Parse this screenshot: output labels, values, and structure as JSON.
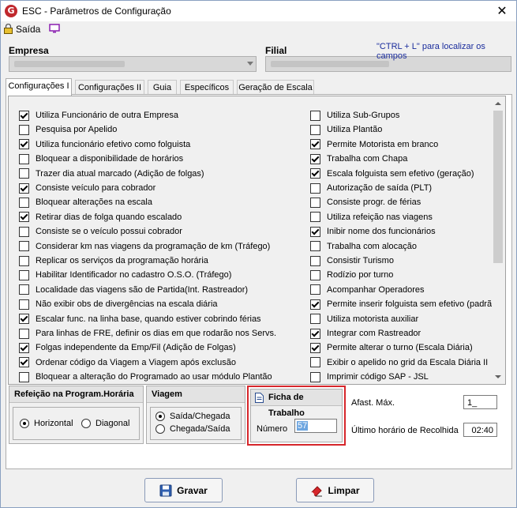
{
  "window": {
    "title": "ESC - Parâmetros de Configuração",
    "close_glyph": "✕",
    "app_glyph": "G"
  },
  "toolbar": {
    "exit_label": "Saída"
  },
  "hint": "\"CTRL + L\" para localizar os campos",
  "header": {
    "empresa_label": "Empresa",
    "filial_label": "Filial"
  },
  "tabs": [
    "Configurações I",
    "Configurações II",
    "Guia",
    "Específicos",
    "Geração de Escala"
  ],
  "left_options": [
    {
      "label": "Utiliza Funcionário de outra Empresa",
      "checked": true
    },
    {
      "label": "Pesquisa por Apelido",
      "checked": false
    },
    {
      "label": "Utiliza funcionário efetivo como folguista",
      "checked": true
    },
    {
      "label": "Bloquear a disponibilidade de horários",
      "checked": false
    },
    {
      "label": "Trazer dia atual marcado (Adição de folgas)",
      "checked": false
    },
    {
      "label": "Consiste veículo para cobrador",
      "checked": true
    },
    {
      "label": "Bloquear alterações na escala",
      "checked": false
    },
    {
      "label": "Retirar dias de folga quando escalado",
      "checked": true
    },
    {
      "label": "Consiste se o veículo possui cobrador",
      "checked": false
    },
    {
      "label": "Considerar km nas viagens da programação de km (Tráfego)",
      "checked": false
    },
    {
      "label": "Replicar os serviços da programação horária",
      "checked": false
    },
    {
      "label": "Habilitar Identificador no cadastro O.S.O. (Tráfego)",
      "checked": false
    },
    {
      "label": "Localidade das viagens são de Partida(Int. Rastreador)",
      "checked": false
    },
    {
      "label": "Não exibir obs de divergências na escala diária",
      "checked": false
    },
    {
      "label": "Escalar func. na linha base, quando estiver cobrindo férias",
      "checked": true
    },
    {
      "label": "Para linhas de FRE, definir os dias em que rodarão nos Servs.",
      "checked": false
    },
    {
      "label": "Folgas independente da Emp/Fil (Adição de Folgas)",
      "checked": true
    },
    {
      "label": "Ordenar código da Viagem a Viagem após exclusão",
      "checked": true
    },
    {
      "label": "Bloquear a alteração do Programado ao usar módulo Plantão",
      "checked": false
    }
  ],
  "right_options": [
    {
      "label": "Utiliza Sub-Grupos",
      "checked": false
    },
    {
      "label": "Utiliza Plantão",
      "checked": false
    },
    {
      "label": "Permite Motorista em branco",
      "checked": true
    },
    {
      "label": "Trabalha com Chapa",
      "checked": true
    },
    {
      "label": "Escala folguista sem efetivo (geração)",
      "checked": true
    },
    {
      "label": "Autorização de saída (PLT)",
      "checked": false
    },
    {
      "label": "Consiste progr. de férias",
      "checked": false
    },
    {
      "label": "Utiliza refeição nas viagens",
      "checked": false
    },
    {
      "label": "Inibir nome dos funcionários",
      "checked": true
    },
    {
      "label": "Trabalha com alocação",
      "checked": false
    },
    {
      "label": "Consistir Turismo",
      "checked": false
    },
    {
      "label": "Rodízio por turno",
      "checked": false
    },
    {
      "label": "Acompanhar Operadores",
      "checked": false
    },
    {
      "label": "Permite inserir folguista sem efetivo (padrão)",
      "checked": true
    },
    {
      "label": "Utiliza motorista auxiliar",
      "checked": false
    },
    {
      "label": "Integrar com Rastreador",
      "checked": true
    },
    {
      "label": "Permite alterar o turno (Escala Diária)",
      "checked": true
    },
    {
      "label": "Exibir o apelido no grid da Escala Diária II",
      "checked": false
    },
    {
      "label": "Imprimir código SAP - JSL",
      "checked": false
    }
  ],
  "refeicao": {
    "title": "Refeição na Program.Horária",
    "options": [
      "Horizontal",
      "Diagonal"
    ],
    "selected": "Horizontal"
  },
  "viagem": {
    "title": "Viagem",
    "options": [
      "Saída/Chegada",
      "Chegada/Saída"
    ],
    "selected": "Saída/Chegada"
  },
  "ficha": {
    "title": "Ficha de Trabalho",
    "numero_label": "Número",
    "numero_value": "57"
  },
  "afast": {
    "label": "Afast. Máx.",
    "value": "1_"
  },
  "recolhida": {
    "label": "Último horário de Recolhida",
    "value": "02:40"
  },
  "buttons": {
    "save": "Gravar",
    "clear": "Limpar"
  }
}
